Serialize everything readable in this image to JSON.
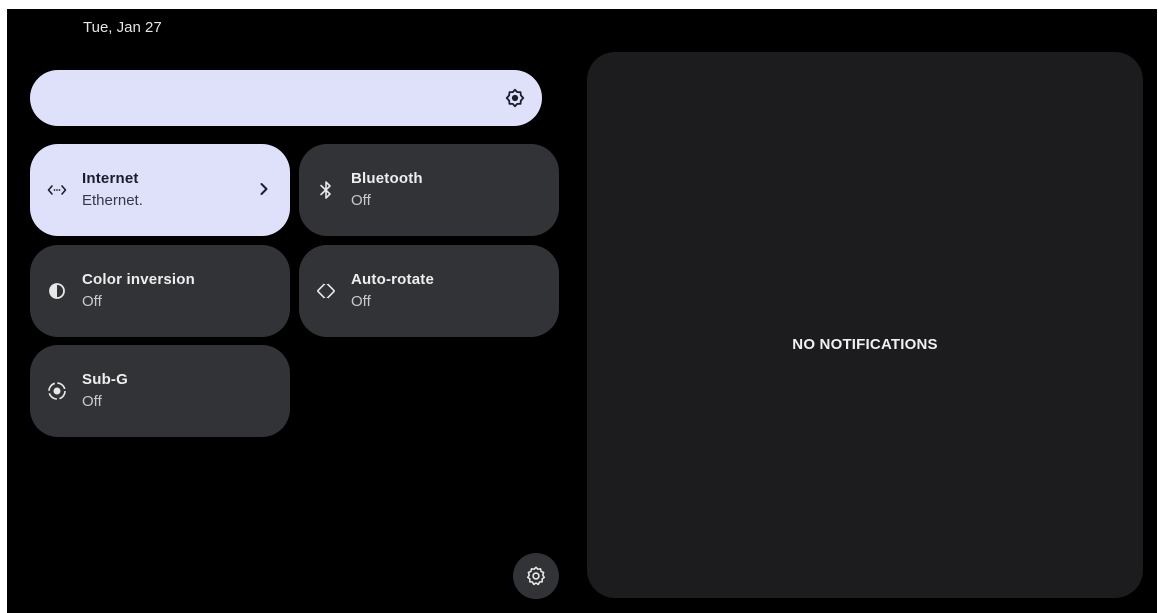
{
  "status_bar": {
    "date": "Tue, Jan 27"
  },
  "brightness": {
    "icon": "brightness-icon"
  },
  "tiles": [
    {
      "label": "Internet",
      "subtitle": "Ethernet.",
      "icon": "ethernet-icon",
      "active": true,
      "has_chevron": true
    },
    {
      "label": "Bluetooth",
      "subtitle": "Off",
      "icon": "bluetooth-icon",
      "active": false
    },
    {
      "label": "Color inversion",
      "subtitle": "Off",
      "icon": "color-inversion-icon",
      "active": false
    },
    {
      "label": "Auto-rotate",
      "subtitle": "Off",
      "icon": "auto-rotate-icon",
      "active": false
    },
    {
      "label": "Sub-G",
      "subtitle": "Off",
      "icon": "radio-target-icon",
      "active": false
    }
  ],
  "settings": {
    "icon": "gear-icon"
  },
  "notifications": {
    "empty_text": "NO NOTIFICATIONS"
  },
  "colors": {
    "background": "#000000",
    "tile_inactive": "#323336",
    "tile_active": "#dfe1fb",
    "panel": "#1c1c1e"
  }
}
